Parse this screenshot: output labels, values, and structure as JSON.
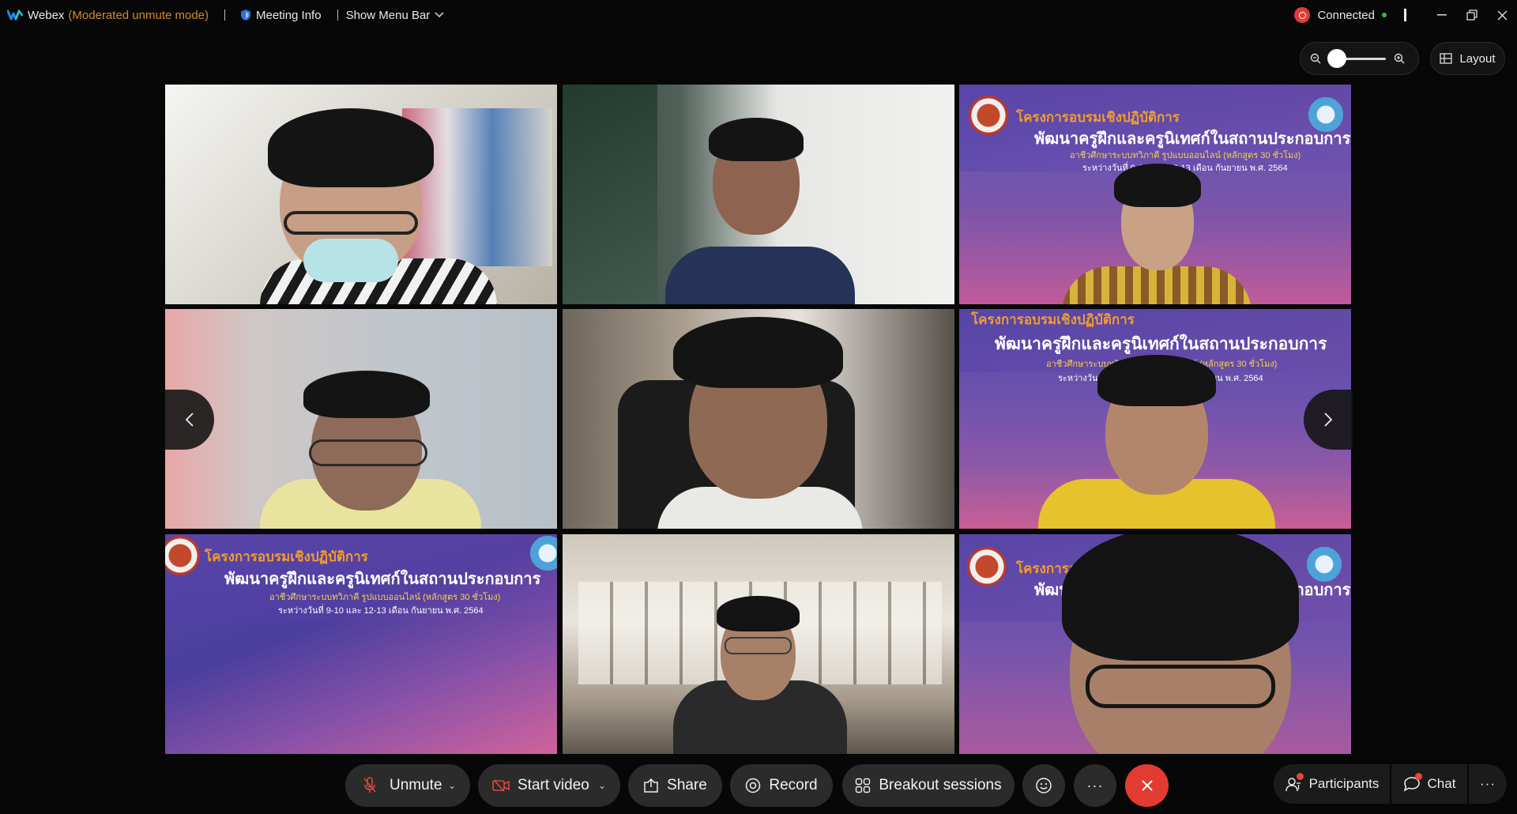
{
  "titlebar": {
    "app_name": "Webex",
    "mode_label": "(Moderated unmute mode)",
    "meeting_info": "Meeting Info",
    "show_menu_bar": "Show Menu Bar",
    "connection_status": "Connected"
  },
  "view_controls": {
    "layout_label": "Layout"
  },
  "banner_text": {
    "project": "โครงการอบรมเชิงปฏิบัติการ",
    "title": "พัฒนาครูฝึกและครูนิเทศก์ในสถานประกอบการ",
    "subtitle": "อาชีวศึกษาระบบทวิภาคี รูปแบบออนไลน์ (หลักสูตร 30 ชั่วโมง)",
    "dates": "ระหว่างวันที่ 9-10 และ 12-13 เดือน กันยายน พ.ศ. 2564"
  },
  "toolbar": {
    "unmute_label": "Unmute",
    "start_video_label": "Start video",
    "share_label": "Share",
    "record_label": "Record",
    "breakout_label": "Breakout sessions",
    "more_label": "···"
  },
  "side_panel": {
    "participants_label": "Participants",
    "chat_label": "Chat",
    "more_label": "···"
  },
  "colors": {
    "end_call": "#e23c32",
    "mode_text": "#d28a2a",
    "connected_badge": "#e03b36",
    "connected_dot": "#39b54a"
  }
}
